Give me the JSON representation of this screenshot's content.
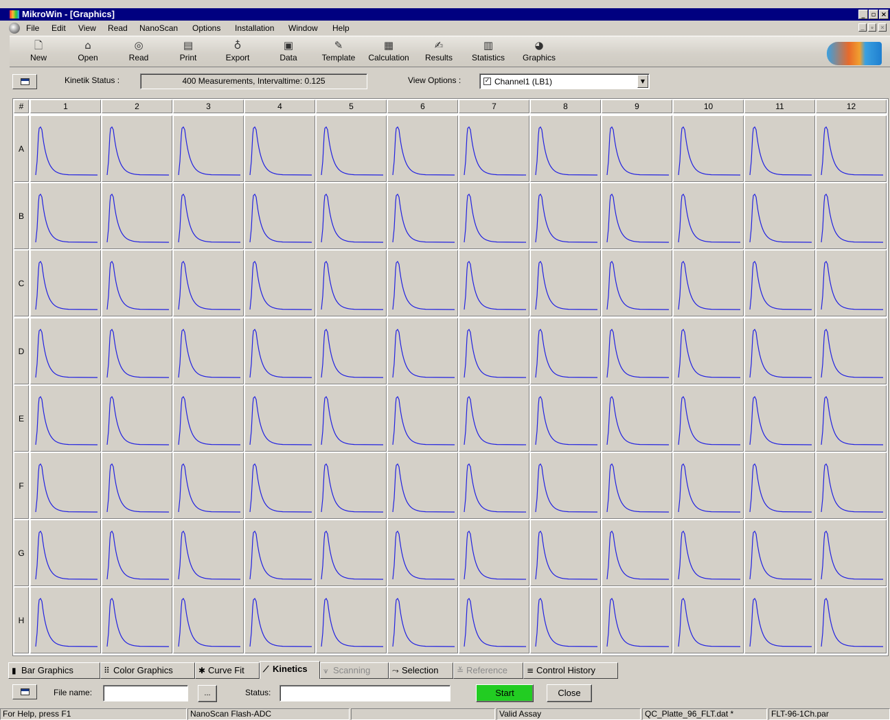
{
  "window": {
    "title": "MikroWin - [Graphics]"
  },
  "menu": [
    "File",
    "Edit",
    "View",
    "Read",
    "NanoScan",
    "Options",
    "Installation",
    "Window",
    "Help"
  ],
  "toolbar": [
    {
      "label": "New",
      "icon": "new-document-icon"
    },
    {
      "label": "Open",
      "icon": "open-house-icon"
    },
    {
      "label": "Read",
      "icon": "read-icon"
    },
    {
      "label": "Print",
      "icon": "printer-icon"
    },
    {
      "label": "Export",
      "icon": "export-icon"
    },
    {
      "label": "Data",
      "icon": "data-icon"
    },
    {
      "label": "Template",
      "icon": "template-icon"
    },
    {
      "label": "Calculation",
      "icon": "calculator-icon"
    },
    {
      "label": "Results",
      "icon": "results-icon"
    },
    {
      "label": "Statistics",
      "icon": "statistics-icon"
    },
    {
      "label": "Graphics",
      "icon": "graphics-icon"
    }
  ],
  "kinetik": {
    "status_label": "Kinetik Status :",
    "status_value": "400 Measurements, Intervaltime: 0.125",
    "view_options_label": "View Options :",
    "view_option_value": "Channel1 (LB1)",
    "view_option_checked": true
  },
  "grid": {
    "corner": "#",
    "columns": [
      "1",
      "2",
      "3",
      "4",
      "5",
      "6",
      "7",
      "8",
      "9",
      "10",
      "11",
      "12"
    ],
    "rows": [
      "A",
      "B",
      "C",
      "D",
      "E",
      "F",
      "G",
      "H"
    ],
    "trace_color": "#2020e0",
    "cell_bg": "#d4d0c8"
  },
  "tabs": [
    {
      "label": "Bar Graphics",
      "icon": "bar-chart-icon",
      "state": "normal"
    },
    {
      "label": "Color Graphics",
      "icon": "color-grid-icon",
      "state": "normal"
    },
    {
      "label": "Curve Fit",
      "icon": "curve-fit-icon",
      "state": "normal"
    },
    {
      "label": "Kinetics",
      "icon": "kinetics-icon",
      "state": "active"
    },
    {
      "label": "Scanning",
      "icon": "scanning-icon",
      "state": "disabled"
    },
    {
      "label": "Selection",
      "icon": "selection-icon",
      "state": "normal"
    },
    {
      "label": "Reference",
      "icon": "reference-icon",
      "state": "disabled"
    },
    {
      "label": "Control History",
      "icon": "history-icon",
      "state": "normal"
    }
  ],
  "controls": {
    "file_name_label": "File name:",
    "file_name_value": "",
    "browse_label": "...",
    "status_label": "Status:",
    "status_value": "",
    "start_label": "Start",
    "start_color": "#22cc22",
    "close_label": "Close"
  },
  "statusbar": [
    "For Help, press F1",
    "NanoScan Flash-ADC",
    "",
    "Valid Assay",
    "QC_Platte_96_FLT.dat *",
    "FLT-96-1Ch.par"
  ]
}
